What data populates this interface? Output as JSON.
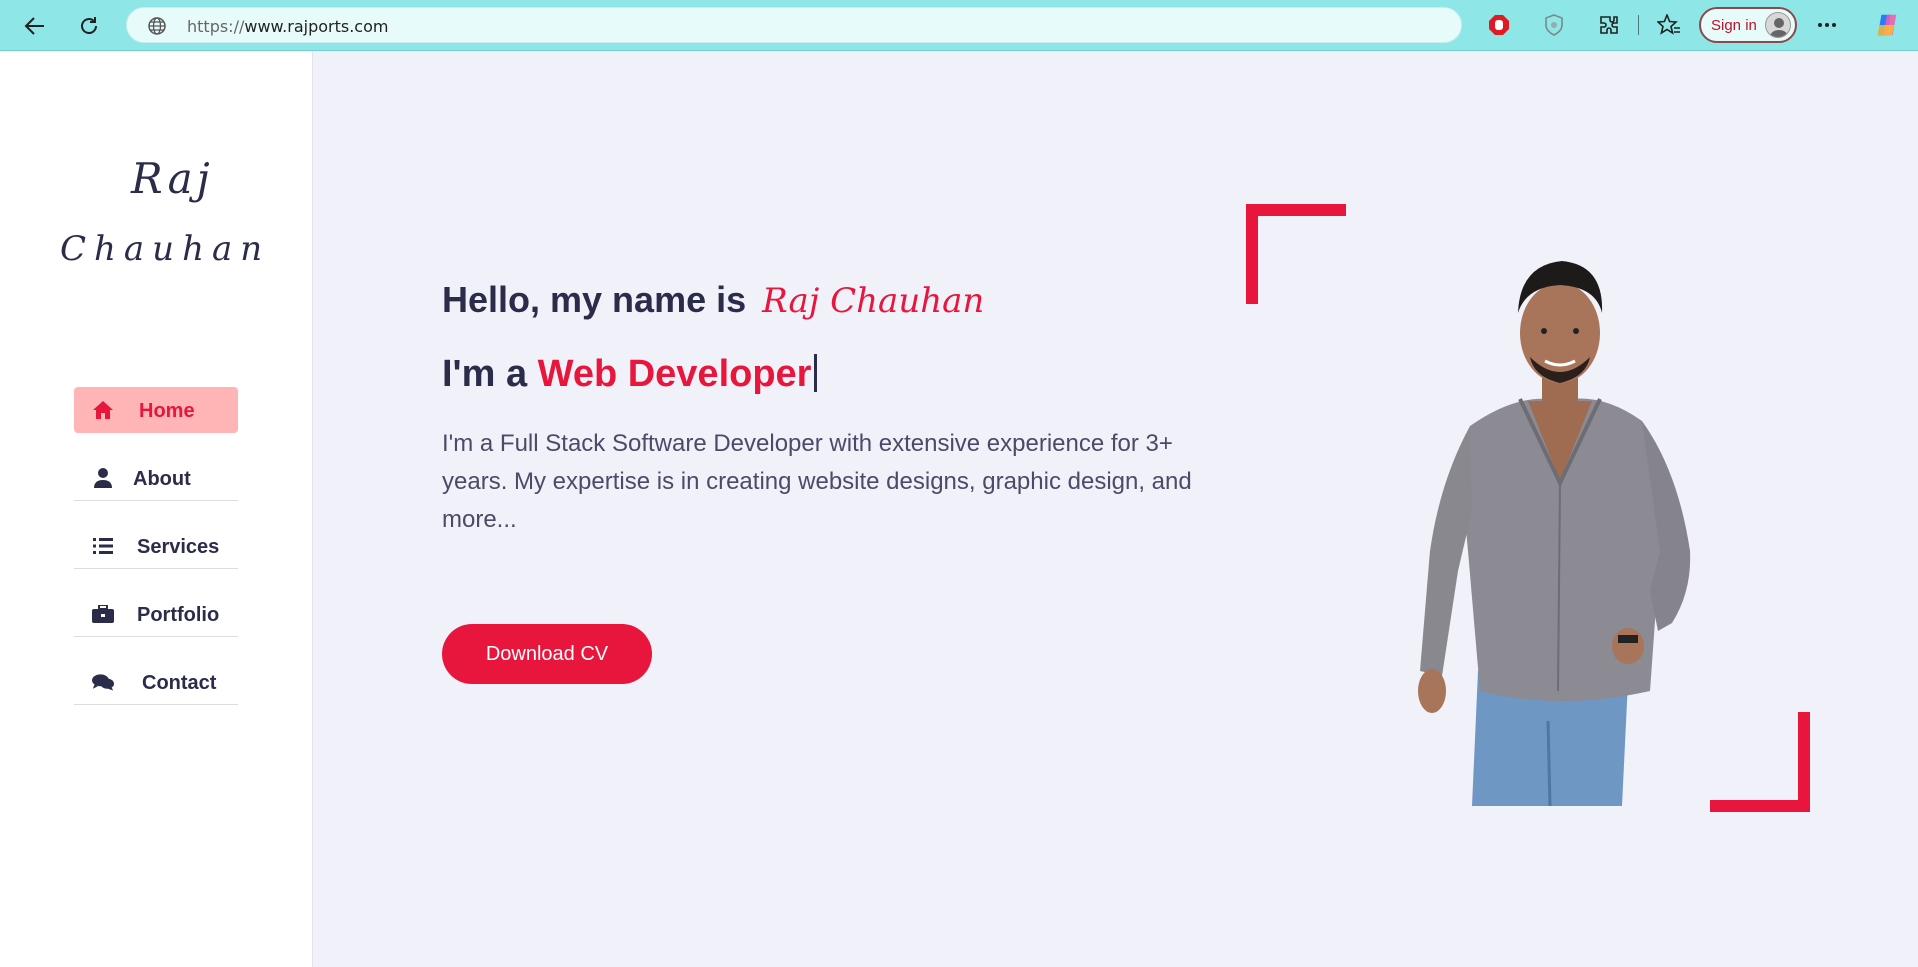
{
  "browser": {
    "url_protocol": "https://",
    "url_host": "www.rajports.com",
    "signin_label": "Sign in",
    "icons": [
      "back-arrow-icon",
      "refresh-icon",
      "globe-icon",
      "adblock-icon",
      "shield-icon",
      "extensions-icon",
      "favorites-icon",
      "avatar-icon",
      "more-icon",
      "copilot-icon"
    ]
  },
  "sidebar": {
    "logo_first": "Raj",
    "logo_last": "Chauhan",
    "items": [
      {
        "label": "Home",
        "icon": "home-icon",
        "active": true
      },
      {
        "label": "About",
        "icon": "user-icon",
        "active": false
      },
      {
        "label": "Services",
        "icon": "list-icon",
        "active": false
      },
      {
        "label": "Portfolio",
        "icon": "briefcase-icon",
        "active": false
      },
      {
        "label": "Contact",
        "icon": "comments-icon",
        "active": false
      }
    ]
  },
  "hero": {
    "greeting": "Hello, my name is",
    "name": "Raj Chauhan",
    "role_prefix": "I'm a",
    "role": "Web Developer",
    "description": "I'm a Full Stack Software Developer with extensive experience for 3+ years. My expertise is in creating website designs, graphic design, and more...",
    "cta_label": "Download CV"
  },
  "colors": {
    "accent": "#e8163c",
    "text_dark": "#2b2c4a",
    "background": "#f1f1fa",
    "browser_bar": "#8ee6e6",
    "nav_active_bg": "#ffb5b5"
  }
}
